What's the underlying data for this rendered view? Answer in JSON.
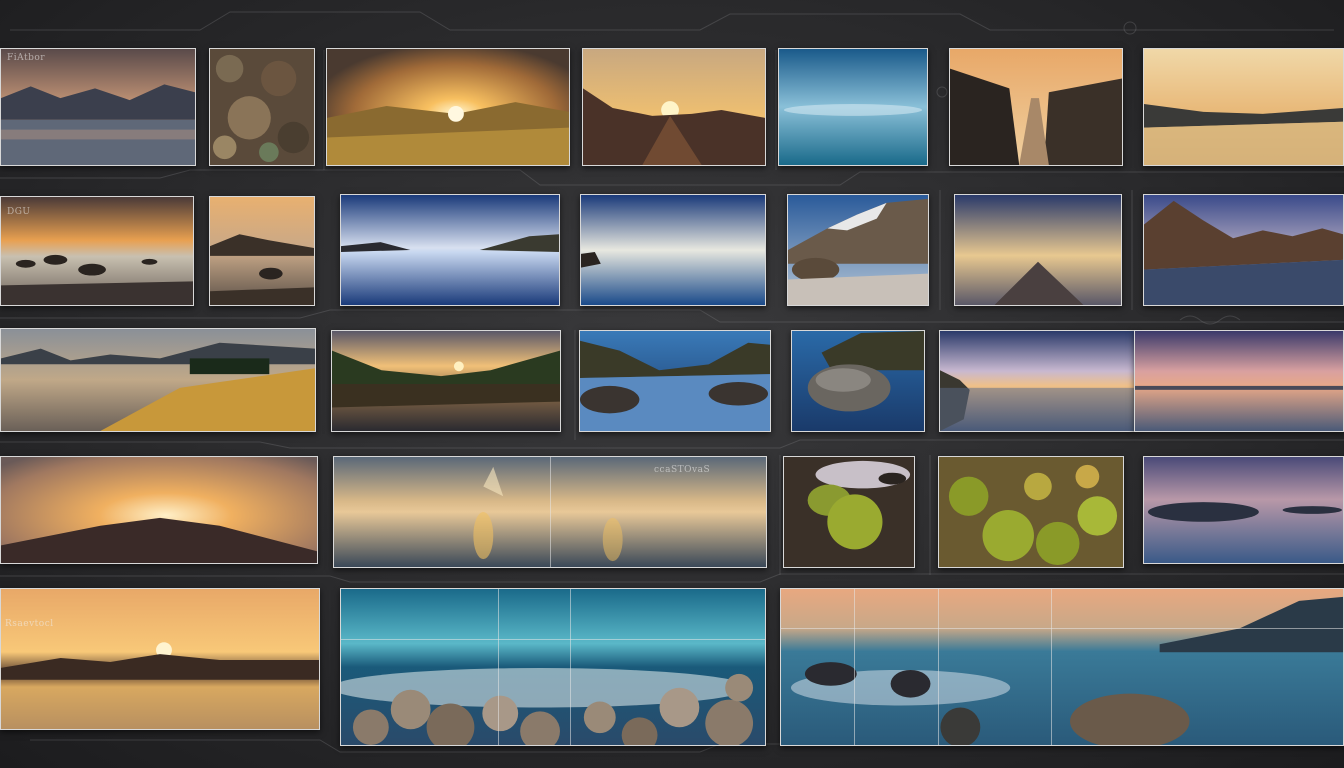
{
  "board": {
    "watermarks": {
      "p1": "FiAtbor",
      "p8": "DGU",
      "p22": "ccaSTOvaS",
      "p27": "Rsaevtocl"
    }
  },
  "photos": [
    {
      "id": "p1",
      "scene": "mountain lake at dusk"
    },
    {
      "id": "p2",
      "scene": "lichen covered rock"
    },
    {
      "id": "p3",
      "scene": "sunburst over golden hills"
    },
    {
      "id": "p4",
      "scene": "sunset behind mountains"
    },
    {
      "id": "p5",
      "scene": "blue long exposure seascape"
    },
    {
      "id": "p6",
      "scene": "canyon road at sunset"
    },
    {
      "id": "p7",
      "scene": "calm river at golden hour"
    },
    {
      "id": "p8",
      "scene": "rocks in lake at sunset"
    },
    {
      "id": "p9",
      "scene": "rocky shore at dusk"
    },
    {
      "id": "p10",
      "scene": "cloud reflection on lake"
    },
    {
      "id": "p11",
      "scene": "blue sky reflection seascape"
    },
    {
      "id": "p12",
      "scene": "snowy mountain peaks"
    },
    {
      "id": "p13",
      "scene": "dusk sky over flat shore"
    },
    {
      "id": "p14",
      "scene": "mountain range over lake"
    },
    {
      "id": "p15",
      "scene": "lake with trees and grasses"
    },
    {
      "id": "p16",
      "scene": "sunset reflected in lake"
    },
    {
      "id": "p17",
      "scene": "blue lake between hills"
    },
    {
      "id": "p18",
      "scene": "boulder in lake"
    },
    {
      "id": "p19",
      "scene": "dusk sea with rocks"
    },
    {
      "id": "p20",
      "scene": "pink sunset over sea"
    },
    {
      "id": "p21",
      "scene": "sun over mountain silhouette"
    },
    {
      "id": "p22",
      "scene": "sunrise reflection panorama"
    },
    {
      "id": "p23",
      "scene": "mossy stones by water"
    },
    {
      "id": "p24",
      "scene": "green moss meadow"
    },
    {
      "id": "p25",
      "scene": "islands at twilight"
    },
    {
      "id": "p26",
      "scene": "sun setting over lake"
    },
    {
      "id": "p27",
      "scene": "waves over rocks with grid"
    },
    {
      "id": "p28",
      "scene": "misty sea and islands with grid"
    }
  ],
  "colors": {
    "frame": "#d8d8d8",
    "background": "#2a2a2c",
    "gold": "#f4b04a",
    "teal": "#2a7c9c"
  }
}
